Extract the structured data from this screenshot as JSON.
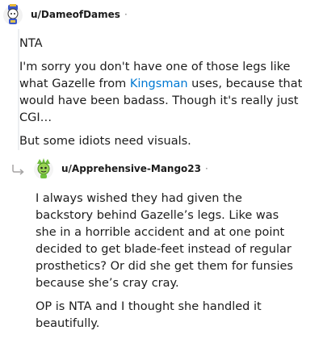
{
  "comments": [
    {
      "username": "u/DameofDames",
      "separator": "·",
      "paragraphs": [
        {
          "text": "NTA"
        },
        {
          "before": "I'm sorry you don't have one of those legs like what Gazelle from ",
          "link": "Kingsman",
          "after": " uses, because that would have been badass. Though it's really just CGI…"
        },
        {
          "text": "But some idiots need visuals."
        }
      ]
    },
    {
      "username": "u/Apprehensive-Mango23",
      "separator": "·",
      "paragraphs": [
        {
          "text": "I always wished they had given the backstory behind Gazelle’s legs. Like was she in a horrible accident and at one point decided to get blade-feet instead of regular prosthetics? Or did she get them for funsies because she’s cray cray."
        },
        {
          "text": "OP is NTA and I thought she handled it beautifully."
        }
      ]
    }
  ],
  "icons": {
    "avatar_1": "snoo-avatar-icon",
    "avatar_2": "snoo-avatar-icon",
    "reply": "reply-arrow-icon"
  },
  "colors": {
    "link": "#0079d3",
    "text": "#1c1c1c",
    "muted": "#7c7c7c"
  }
}
